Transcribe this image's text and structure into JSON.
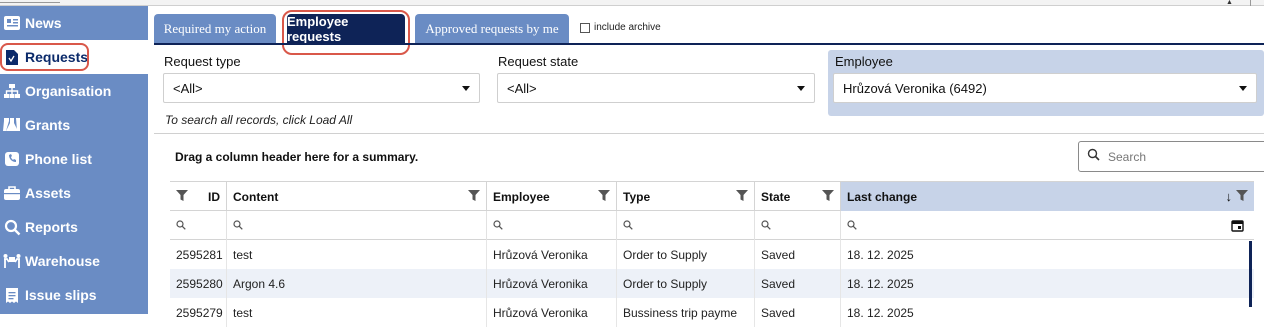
{
  "sidebar": {
    "items": [
      {
        "label": "News",
        "icon": "newspaper-icon"
      },
      {
        "label": "Requests",
        "icon": "file-icon",
        "active": true
      },
      {
        "label": "Organisation",
        "icon": "sitemap-icon"
      },
      {
        "label": "Grants",
        "icon": "flask-icon"
      },
      {
        "label": "Phone list",
        "icon": "phone-icon"
      },
      {
        "label": "Assets",
        "icon": "briefcase-icon"
      },
      {
        "label": "Reports",
        "icon": "search-icon"
      },
      {
        "label": "Warehouse",
        "icon": "people-carry-icon"
      },
      {
        "label": "Issue slips",
        "icon": "receipt-icon"
      }
    ],
    "bg_color": "#6a8cc4"
  },
  "tabs": [
    {
      "label": "Required my action",
      "active": false
    },
    {
      "label": "Employee requests",
      "active": true
    },
    {
      "label": "Approved requests by me",
      "active": false
    }
  ],
  "include_archive": {
    "label": "include archive",
    "checked": false
  },
  "filters": {
    "request_type": {
      "label": "Request type",
      "value": "<All>"
    },
    "request_state": {
      "label": "Request state",
      "value": "<All>"
    },
    "employee": {
      "label": "Employee",
      "value": "Hrůzová Veronika (6492)"
    }
  },
  "hint": "To search all records, click Load All",
  "grid": {
    "group_hint": "Drag a column header here for a summary.",
    "search_placeholder": "Search",
    "columns": [
      "ID",
      "Content",
      "Employee",
      "Type",
      "State",
      "Last change"
    ],
    "sort_column": "Last change",
    "sort_direction": "descending",
    "rows": [
      [
        "2595281",
        "test",
        "Hrůzová Veronika",
        "Order to Supply",
        "Saved",
        "18. 12. 2025"
      ],
      [
        "2595280",
        "Argon 4.6",
        "Hrůzová Veronika",
        "Order to Supply",
        "Saved",
        "18. 12. 2025"
      ],
      [
        "2595279",
        "test",
        "Hrůzová Veronika",
        "Bussiness trip payme",
        "Saved",
        "18. 12. 2025"
      ]
    ]
  },
  "colors": {
    "accent_dark": "#0e2357",
    "highlight": "#d9584a",
    "sorted_header": "#c7d3e8"
  }
}
